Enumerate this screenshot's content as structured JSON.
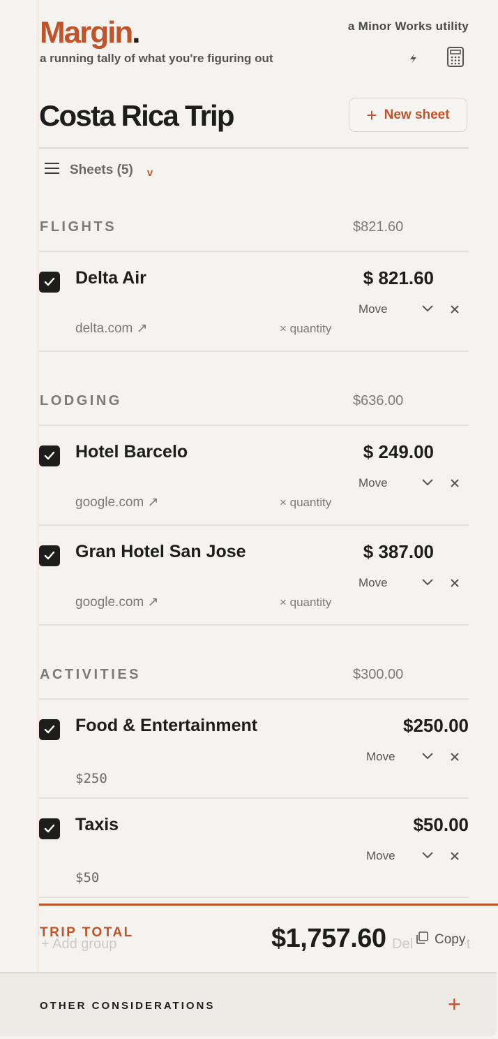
{
  "brand": {
    "logo_text": "Margin",
    "logo_dot": ".",
    "byline": "a Minor Works utility",
    "tagline": "a running tally of what you're figuring out"
  },
  "header": {
    "title": "Costa Rica Trip",
    "new_sheet_label": "New sheet",
    "new_sheet_icon": "plus-icon"
  },
  "sheets": {
    "label": "Sheets (5)",
    "chevron": "v"
  },
  "groups": [
    {
      "name": "FLIGHTS",
      "total": "$821.60",
      "items": [
        {
          "name": "Delta Air",
          "price": "$ 821.60",
          "link": "delta.com ↗",
          "quantity": "× quantity",
          "move": "Move",
          "checked": true
        }
      ]
    },
    {
      "name": "LODGING",
      "total": "$636.00",
      "items": [
        {
          "name": "Hotel Barcelo",
          "price": "$ 249.00",
          "link": "google.com ↗",
          "quantity": "× quantity",
          "move": "Move",
          "checked": true
        },
        {
          "name": "Gran Hotel San Jose",
          "price": "$ 387.00",
          "link": "google.com ↗",
          "quantity": "× quantity",
          "move": "Move",
          "checked": true
        }
      ]
    },
    {
      "name": "ACTIVITIES",
      "total": "$300.00",
      "items": [
        {
          "name": "Food & Entertainment",
          "price": "$250.00",
          "note": "$250",
          "move": "Move",
          "checked": true
        },
        {
          "name": "Taxis",
          "price": "$50.00",
          "note": "$50",
          "move": "Move",
          "checked": true
        }
      ]
    }
  ],
  "footer": {
    "total_label": "TRIP TOTAL",
    "total_value": "$1,757.60",
    "copy_label": "Copy",
    "ghost_add": "+ Add group",
    "ghost_delete": "Delete sheet"
  },
  "other": {
    "label": "OTHER CONSIDERATIONS",
    "plus": "+"
  },
  "colors": {
    "accent": "#c2522a",
    "ink": "#1d1d1b",
    "paper": "#f4f3ef",
    "muted": "#7b7b74"
  }
}
